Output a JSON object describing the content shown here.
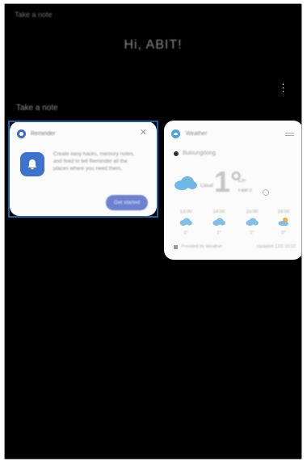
{
  "screen": {
    "top_hint": "Take a note",
    "greeting": "Hi, ABIT!",
    "overflow_menu": "⋮",
    "section_label": "Take a note"
  },
  "reminder_card": {
    "app_name": "Reminder",
    "close_glyph": "✕",
    "icon": "bell-icon",
    "description": "Create easy hacks, memory notes, and feed to tell Reminder all the places where you need them.",
    "action_label": "Get started",
    "accent_color": "#3d72cf",
    "highlight_color": "#1d5fa8"
  },
  "weather_card": {
    "app_name": "Weather",
    "location": "Bukiungdong",
    "condition": "Cloud",
    "temperature": "1°",
    "unit": "C/F",
    "extra": "Feel 0",
    "forecast": [
      {
        "time": "13:00",
        "icon": "cloud-icon",
        "value": "1°"
      },
      {
        "time": "14:00",
        "icon": "cloud-icon",
        "value": "1°"
      },
      {
        "time": "15:00",
        "icon": "cloud-icon",
        "value": "1°"
      },
      {
        "time": "16:00",
        "icon": "cloud-sun-icon",
        "value": "0°"
      }
    ],
    "footer_left": "Provided by Weather",
    "footer_right": "Updated 12/3 10:02"
  }
}
